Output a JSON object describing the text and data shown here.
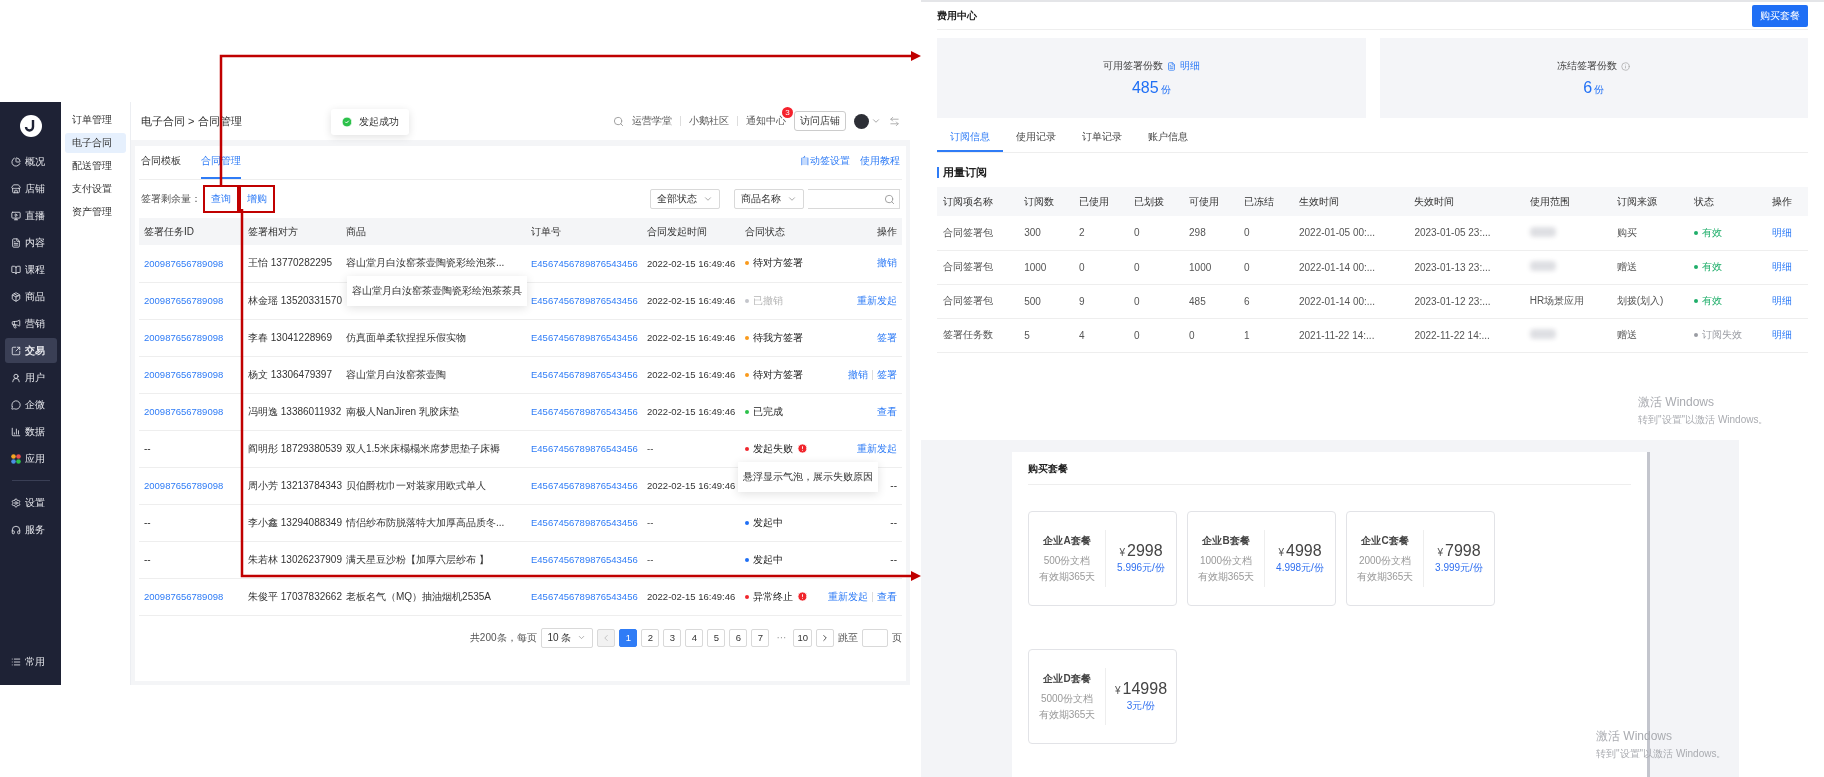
{
  "contract_screen": {
    "nav": [
      {
        "label": "概况",
        "selected": false
      },
      {
        "label": "店铺",
        "selected": false
      },
      {
        "label": "直播",
        "selected": false
      },
      {
        "label": "内容",
        "selected": false
      },
      {
        "label": "课程",
        "selected": false
      },
      {
        "label": "商品",
        "selected": false
      },
      {
        "label": "营销",
        "selected": false
      },
      {
        "label": "交易",
        "selected": true
      },
      {
        "label": "用户",
        "selected": false
      },
      {
        "label": "企微",
        "selected": false
      },
      {
        "label": "数据",
        "selected": false
      },
      {
        "label": "应用",
        "selected": false
      }
    ],
    "nav_lower": [
      {
        "label": "设置",
        "selected": false
      },
      {
        "label": "服务",
        "selected": false
      }
    ],
    "nav_footer": "常用",
    "submenu": [
      {
        "label": "订单管理",
        "selected": false
      },
      {
        "label": "电子合同",
        "selected": true
      },
      {
        "label": "配送管理",
        "selected": false
      },
      {
        "label": "支付设置",
        "selected": false
      },
      {
        "label": "资产管理",
        "selected": false
      }
    ],
    "breadcrumb": "电子合同 > 合同管理",
    "header_links": [
      {
        "label": "运营学堂"
      },
      {
        "label": "小鹅社区"
      },
      {
        "label": "通知中心",
        "badge": "3"
      }
    ],
    "visit_button": "访问店铺",
    "toast": "发起成功",
    "tabs": [
      {
        "label": "合同模板",
        "selected": false
      },
      {
        "label": "合同管理",
        "selected": true
      }
    ],
    "tab_links": [
      "自动签设置",
      "使用教程"
    ],
    "quota_label": "签署剩余量：",
    "quota_links": [
      {
        "label": "查询",
        "highlighted": true
      },
      {
        "label": "增购",
        "highlighted": true
      }
    ],
    "status_filter": "全部状态",
    "search_type": "商品名称",
    "columns": [
      "签署任务ID",
      "签署相对方",
      "商品",
      "订单号",
      "合同发起时间",
      "合同状态",
      "操作"
    ],
    "rows": [
      {
        "task_id": "200987656789098",
        "id_link": true,
        "party": "王怡 13770282295",
        "product": "容山堂月白汝窑茶壶陶瓷彩绘泡茶...",
        "product_tooltip": "容山堂月白汝窑茶壶陶瓷彩绘泡茶茶具",
        "order": "E4567456789876543456",
        "time": "2022-02-15 16:49:46",
        "status": "待对方签署",
        "color": "#fa9a1c",
        "muted": false,
        "error": false,
        "actions": [
          {
            "label": "撤销",
            "kind": "link"
          }
        ]
      },
      {
        "task_id": "200987656789098",
        "id_link": true,
        "party": "林金瑶 13520331570",
        "order": "E4567456789876543456",
        "time": "2022-02-15 16:49:46",
        "status": "已撤销",
        "color": "#c4c6cc",
        "muted": true,
        "error": false,
        "actions": [
          {
            "label": "重新发起",
            "kind": "link"
          }
        ]
      },
      {
        "task_id": "200987656789098",
        "id_link": true,
        "party": "李春 13041228969",
        "product": "仿真面单柔软捏捏乐假实物",
        "order": "E4567456789876543456",
        "time": "2022-02-15 16:49:46",
        "status": "待我方签署",
        "color": "#fa9a1c",
        "muted": false,
        "error": false,
        "actions": [
          {
            "label": "签署",
            "kind": "link"
          }
        ]
      },
      {
        "task_id": "200987656789098",
        "id_link": true,
        "party": "杨文 13306479397",
        "product": "容山堂月白汝窑茶壶陶",
        "order": "E4567456789876543456",
        "time": "2022-02-15 16:49:46",
        "status": "待对方签署",
        "color": "#fa9a1c",
        "muted": false,
        "error": false,
        "actions": [
          {
            "label": "撤销",
            "kind": "link"
          },
          {
            "label": "签署",
            "kind": "link"
          }
        ]
      },
      {
        "task_id": "200987656789098",
        "id_link": true,
        "party": "冯明逸 13386011932",
        "product": "南极人NanJiren 乳胶床垫",
        "order": "E4567456789876543456",
        "time": "2022-02-15 16:49:46",
        "status": "已完成",
        "color": "#2cc14a",
        "muted": false,
        "error": false,
        "actions": [
          {
            "label": "查看",
            "kind": "link"
          }
        ]
      },
      {
        "task_id": "--",
        "id_link": false,
        "party": "阎明彤 18729380539",
        "product": "双人1.5米床榻榻米席梦思垫子床褥",
        "order": "E4567456789876543456",
        "time": "--",
        "status": "发起失败",
        "color": "#f0262d",
        "muted": false,
        "error": true,
        "status_tooltip": "悬浮显示气泡，展示失败原因",
        "actions": [
          {
            "label": "重新发起",
            "kind": "link"
          }
        ]
      },
      {
        "task_id": "200987656789098",
        "id_link": true,
        "party": "周小芳 13213784343",
        "product": "贝伯爵枕巾一对装家用欧式单人",
        "order": "E4567456789876543456",
        "time": "2022-02-15 16:49:46",
        "actions": [
          {
            "label": "--",
            "kind": "none"
          }
        ]
      },
      {
        "task_id": "--",
        "id_link": false,
        "party": "李小鑫 13294088349",
        "product": "情侣纱布防脱落特大加厚高品质冬...",
        "order": "E4567456789876543456",
        "time": "--",
        "status": "发起中",
        "color": "#1f6ff5",
        "muted": false,
        "error": false,
        "actions": [
          {
            "label": "--",
            "kind": "none"
          }
        ]
      },
      {
        "task_id": "--",
        "id_link": false,
        "party": "朱若林 13026237909",
        "product": "满天星豆沙粉【加厚六层纱布 】",
        "order": "E4567456789876543456",
        "time": "--",
        "status": "发起中",
        "color": "#1f6ff5",
        "muted": false,
        "error": false,
        "actions": [
          {
            "label": "--",
            "kind": "none"
          }
        ]
      },
      {
        "task_id": "200987656789098",
        "id_link": true,
        "party": "朱俊平 17037832662",
        "product": "老板名气（MQ）抽油烟机2535A",
        "order": "E4567456789876543456",
        "time": "2022-02-15 16:49:46",
        "status": "异常终止",
        "color": "#f0262d",
        "muted": false,
        "error": true,
        "actions": [
          {
            "label": "重新发起",
            "kind": "link"
          },
          {
            "label": "查看",
            "kind": "link"
          }
        ]
      }
    ],
    "pagination": {
      "total": "共200条，每页",
      "page_size": "10 条",
      "prev_disabled": true,
      "pages": [
        {
          "kind": "page",
          "label": "1",
          "selected": true
        },
        {
          "kind": "page",
          "label": "2",
          "selected": false
        },
        {
          "kind": "page",
          "label": "3",
          "selected": false
        },
        {
          "kind": "page",
          "label": "4",
          "selected": false
        },
        {
          "kind": "page",
          "label": "5",
          "selected": false
        },
        {
          "kind": "page",
          "label": "6",
          "selected": false
        },
        {
          "kind": "page",
          "label": "7",
          "selected": false
        },
        {
          "kind": "ellipsis",
          "label": "···"
        },
        {
          "kind": "page",
          "label": "10",
          "selected": false
        }
      ],
      "jump_label": "跳至",
      "jump_unit": "页"
    }
  },
  "fee_center": {
    "title": "费用中心",
    "buy_button": "购买套餐",
    "stats": [
      {
        "label": "可用签署份数",
        "link": "明细",
        "info": false,
        "value": "485",
        "unit": "份"
      },
      {
        "label": "冻结签署份数",
        "info": true,
        "value": "6",
        "unit": "份"
      }
    ],
    "tabs": [
      {
        "label": "订阅信息",
        "selected": true
      },
      {
        "label": "使用记录",
        "selected": false
      },
      {
        "label": "订单记录",
        "selected": false
      },
      {
        "label": "账户信息",
        "selected": false
      }
    ],
    "section_title": "用量订阅",
    "columns": [
      "订阅项名称",
      "订阅数",
      "已使用",
      "已划拨",
      "可使用",
      "已冻结",
      "生效时间",
      "失效时间",
      "使用范围",
      "订阅来源",
      "状态",
      "操作"
    ],
    "rows": [
      {
        "name": "合同签署包",
        "count": "300",
        "used": "2",
        "allotted": "0",
        "available": "298",
        "frozen": "0",
        "start": "2022-01-05 00:...",
        "end": "2023-01-05 23:...",
        "scope_hidden": true,
        "source": "购买",
        "status": "有效",
        "color": "#1fae6a",
        "action": "明细"
      },
      {
        "name": "合同签署包",
        "count": "1000",
        "used": "0",
        "allotted": "0",
        "available": "1000",
        "frozen": "0",
        "start": "2022-01-14 00:...",
        "end": "2023-01-13 23:...",
        "scope_hidden": true,
        "source": "赠送",
        "status": "有效",
        "color": "#1fae6a",
        "action": "明细"
      },
      {
        "name": "合同签署包",
        "count": "500",
        "used": "9",
        "allotted": "0",
        "available": "485",
        "frozen": "6",
        "start": "2022-01-14 00:...",
        "end": "2023-01-12 23:...",
        "scope_hidden": false,
        "scope": "HR场景应用",
        "source": "划拨(划入)",
        "status": "有效",
        "color": "#1fae6a",
        "action": "明细"
      },
      {
        "name": "签署任务数",
        "count": "5",
        "used": "4",
        "allotted": "0",
        "available": "0",
        "frozen": "1",
        "start": "2021-11-22 14:...",
        "end": "2022-11-22 14:...",
        "scope_hidden": true,
        "source": "赠送",
        "status": "订阅失效",
        "color": "#9a9ca3",
        "action": "明细"
      }
    ],
    "watermark": {
      "title": "激活 Windows",
      "hint": "转到\"设置\"以激活 Windows。"
    }
  },
  "packages": {
    "title": "购买套餐",
    "items": [
      {
        "name": "企业A套餐",
        "docs": "500份文档",
        "validity": "有效期365天",
        "currency": "¥",
        "price": "2998",
        "unit_price": "5.996元/份"
      },
      {
        "name": "企业B套餐",
        "docs": "1000份文档",
        "validity": "有效期365天",
        "currency": "¥",
        "price": "4998",
        "unit_price": "4.998元/份"
      },
      {
        "name": "企业C套餐",
        "docs": "2000份文档",
        "validity": "有效期365天",
        "currency": "¥",
        "price": "7998",
        "unit_price": "3.999元/份"
      },
      {
        "name": "企业D套餐",
        "docs": "5000份文档",
        "validity": "有效期365天",
        "currency": "¥",
        "price": "14998",
        "unit_price": "3元/份"
      }
    ],
    "watermark": {
      "title": "激活 Windows",
      "hint": "转到\"设置\"以激活 Windows。"
    }
  }
}
